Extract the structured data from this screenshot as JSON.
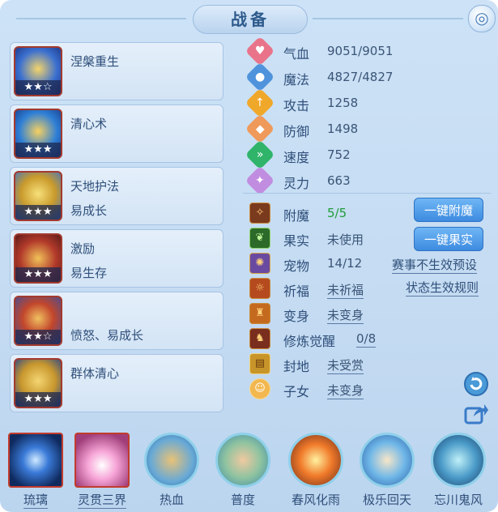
{
  "title": "战备",
  "skills": [
    {
      "name": "涅槃重生",
      "sub": "",
      "stars": "★★☆"
    },
    {
      "name": "清心术",
      "sub": "",
      "stars": "★★★"
    },
    {
      "name": "天地护法",
      "sub": "易成长",
      "stars": "★★★"
    },
    {
      "name": "激励",
      "sub": "易生存",
      "stars": "★★★"
    },
    {
      "name": "",
      "sub": "愤怒、易成长",
      "stars": "★★☆"
    },
    {
      "name": "群体清心",
      "sub": "",
      "stars": "★★★"
    }
  ],
  "stats": [
    {
      "label": "气血",
      "value": "9051/9051",
      "icon": "heart-icon",
      "color": "#e9748a"
    },
    {
      "label": "魔法",
      "value": "4827/4827",
      "icon": "mana-icon",
      "color": "#4f93dc"
    },
    {
      "label": "攻击",
      "value": "1258",
      "icon": "attack-icon",
      "color": "#f0a82a"
    },
    {
      "label": "防御",
      "value": "1498",
      "icon": "defense-icon",
      "color": "#ef9a5a"
    },
    {
      "label": "速度",
      "value": "752",
      "icon": "speed-icon",
      "color": "#2fb46a"
    },
    {
      "label": "灵力",
      "value": "663",
      "icon": "spirit-icon",
      "color": "#c18de0"
    }
  ],
  "attrs": [
    {
      "label": "附魔",
      "value": "5/5"
    },
    {
      "label": "果实",
      "value": "未使用"
    },
    {
      "label": "宠物",
      "value": "14/12"
    },
    {
      "label": "祈福",
      "value": "未祈福"
    },
    {
      "label": "变身",
      "value": "未变身"
    },
    {
      "label": "修炼觉醒",
      "value": "0/8"
    },
    {
      "label": "封地",
      "value": "未受赏"
    },
    {
      "label": "子女",
      "value": "未变身"
    }
  ],
  "buttons": {
    "enchant": "一键附魔",
    "fruit": "一键果实"
  },
  "links": {
    "preset": "赛事不生效预设",
    "rules": "状态生效规则"
  },
  "bottom_skills": [
    {
      "label": "琉璃"
    },
    {
      "label": "灵贯三界"
    },
    {
      "label": "热血"
    },
    {
      "label": "普度"
    },
    {
      "label": "春风化雨"
    },
    {
      "label": "极乐回天"
    },
    {
      "label": "忘川鬼风"
    }
  ]
}
